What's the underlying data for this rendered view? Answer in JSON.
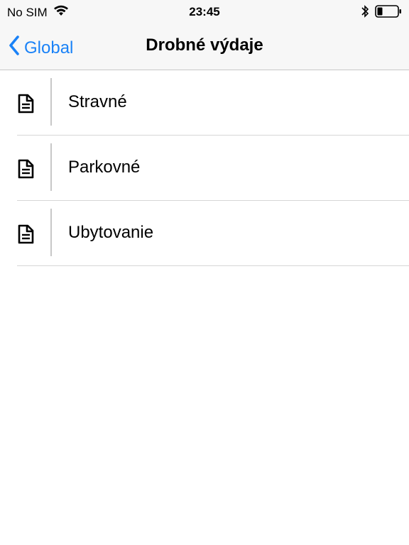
{
  "status_bar": {
    "carrier": "No SIM",
    "time": "23:45"
  },
  "nav": {
    "back_label": "Global",
    "title": "Drobné výdaje"
  },
  "items": [
    {
      "label": "Stravné",
      "icon": "document-icon"
    },
    {
      "label": "Parkovné",
      "icon": "document-icon"
    },
    {
      "label": "Ubytovanie",
      "icon": "document-icon"
    }
  ],
  "colors": {
    "accent": "#1a82f7",
    "bar_background": "#f7f7f7",
    "separator": "#d6d6d6"
  }
}
